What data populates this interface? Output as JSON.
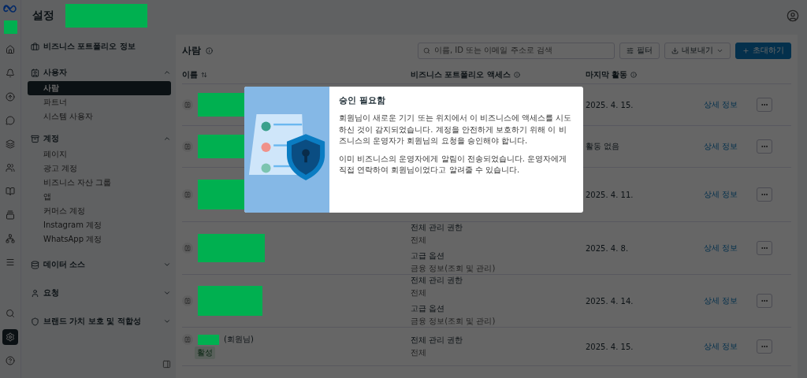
{
  "app": {
    "title": "설정"
  },
  "rail": [
    {
      "selected": false
    },
    {
      "selected": false
    },
    {
      "selected": false
    },
    {
      "selected": false
    },
    {
      "selected": false
    },
    {
      "selected": false
    },
    {
      "selected": false
    },
    {
      "selected": false
    },
    {
      "selected": false
    },
    {
      "selected": false
    },
    {
      "selected": false
    },
    {
      "selected": true
    },
    {
      "selected": false
    }
  ],
  "sidebar": {
    "top_item": {
      "label": "비즈니스 포트폴리오 정보"
    },
    "sections": [
      {
        "label": "사용자",
        "expanded": true,
        "items": [
          {
            "label": "사람",
            "selected": true
          },
          {
            "label": "파트너",
            "selected": false
          },
          {
            "label": "시스템 사용자",
            "selected": false
          }
        ]
      },
      {
        "label": "계정",
        "expanded": true,
        "items": [
          {
            "label": "페이지",
            "selected": false
          },
          {
            "label": "광고 계정",
            "selected": false
          },
          {
            "label": "비즈니스 자산 그룹",
            "selected": false
          },
          {
            "label": "앱",
            "selected": false
          },
          {
            "label": "커머스 계정",
            "selected": false
          },
          {
            "label": "Instagram 계정",
            "selected": false
          },
          {
            "label": "WhatsApp 계정",
            "selected": false
          }
        ]
      },
      {
        "label": "데이터 소스",
        "expanded": false
      },
      {
        "label": "요청",
        "expanded": false
      },
      {
        "label": "브랜드 가치 보호 및 적합성",
        "expanded": false
      }
    ]
  },
  "main": {
    "title": "사람",
    "search": {
      "placeholder": "이름, ID 또는 이메일 주소로 검색"
    },
    "buttons": [
      {
        "label": "필터",
        "kind": "filter"
      },
      {
        "label": "내보내기",
        "kind": "export"
      },
      {
        "label": "초대하기",
        "kind": "invite"
      }
    ],
    "table": {
      "columns": [
        {
          "label": "이름",
          "kind": "sort"
        },
        {
          "label": "비즈니스 포트폴리오 액세스",
          "kind": "info"
        },
        {
          "label": "마지막 활동",
          "kind": "info"
        }
      ],
      "rows": [
        {
          "access": [],
          "last_activity": "2025. 4. 15.",
          "link": "상세 정보"
        },
        {
          "access": [],
          "last_activity": "활동 없음",
          "link": "상세 정보"
        },
        {
          "access": [],
          "last_activity": "2025. 4. 11.",
          "link": "상세 정보"
        },
        {
          "access": [
            {
              "title": "전체 관리 권한",
              "detail": "전체"
            },
            {
              "title": "고급 옵션",
              "detail": "금융 정보(조회 및 관리)"
            }
          ],
          "last_activity": "2025. 4. 8.",
          "link": "상세 정보"
        },
        {
          "access": [
            {
              "title": "전체 관리 권한",
              "detail": "전체"
            },
            {
              "title": "고급 옵션",
              "detail": "금융 정보(조회 및 관리)"
            }
          ],
          "last_activity": "2025. 4. 14.",
          "link": "상세 정보"
        },
        {
          "name_suffix": "(회원님)",
          "badge": "활성",
          "access": [
            {
              "title": "전체 관리 권한",
              "detail": "전체"
            }
          ],
          "last_activity": "2025. 4. 15.",
          "link": "상세 정보"
        }
      ]
    }
  },
  "dialog": {
    "title": "승인 필요함",
    "paragraphs": [
      "회원님이 새로운 기기 또는 위치에서 이 비즈니스에 액세스를 시도하신 것이 감지되었습니다. 계정을 안전하게 보호하기 위해 이 비즈니스의 운영자가 회원님의 요청을 승인해야 합니다.",
      "이미 비즈니스의 운영자에게 알림이 전송되었습니다. 운영자에게 직접 연락하여 회원님이었다고 알려줄 수 있습니다."
    ]
  }
}
